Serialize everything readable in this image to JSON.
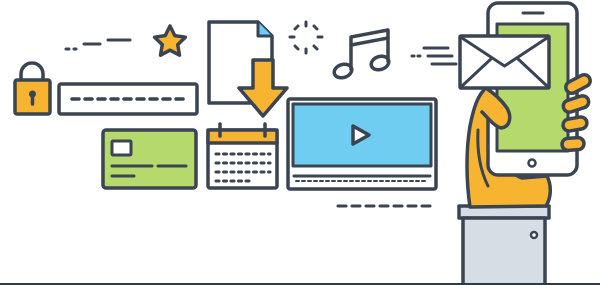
{
  "palette": {
    "outline": "#3a4452",
    "yellow": "#f6b431",
    "green": "#b5d96d",
    "blue": "#6ecdf0",
    "paper": "#ffffff",
    "sleeve": "#d6dde5",
    "ground": "#2f3a47"
  },
  "icons": [
    "padlock-icon",
    "password-field-icon",
    "star-icon",
    "document-icon",
    "download-arrow-icon",
    "loading-spinner-icon",
    "music-note-icon",
    "credit-card-icon",
    "calendar-icon",
    "video-player-icon",
    "play-icon",
    "envelope-icon",
    "smartphone-icon",
    "hand-icon"
  ]
}
